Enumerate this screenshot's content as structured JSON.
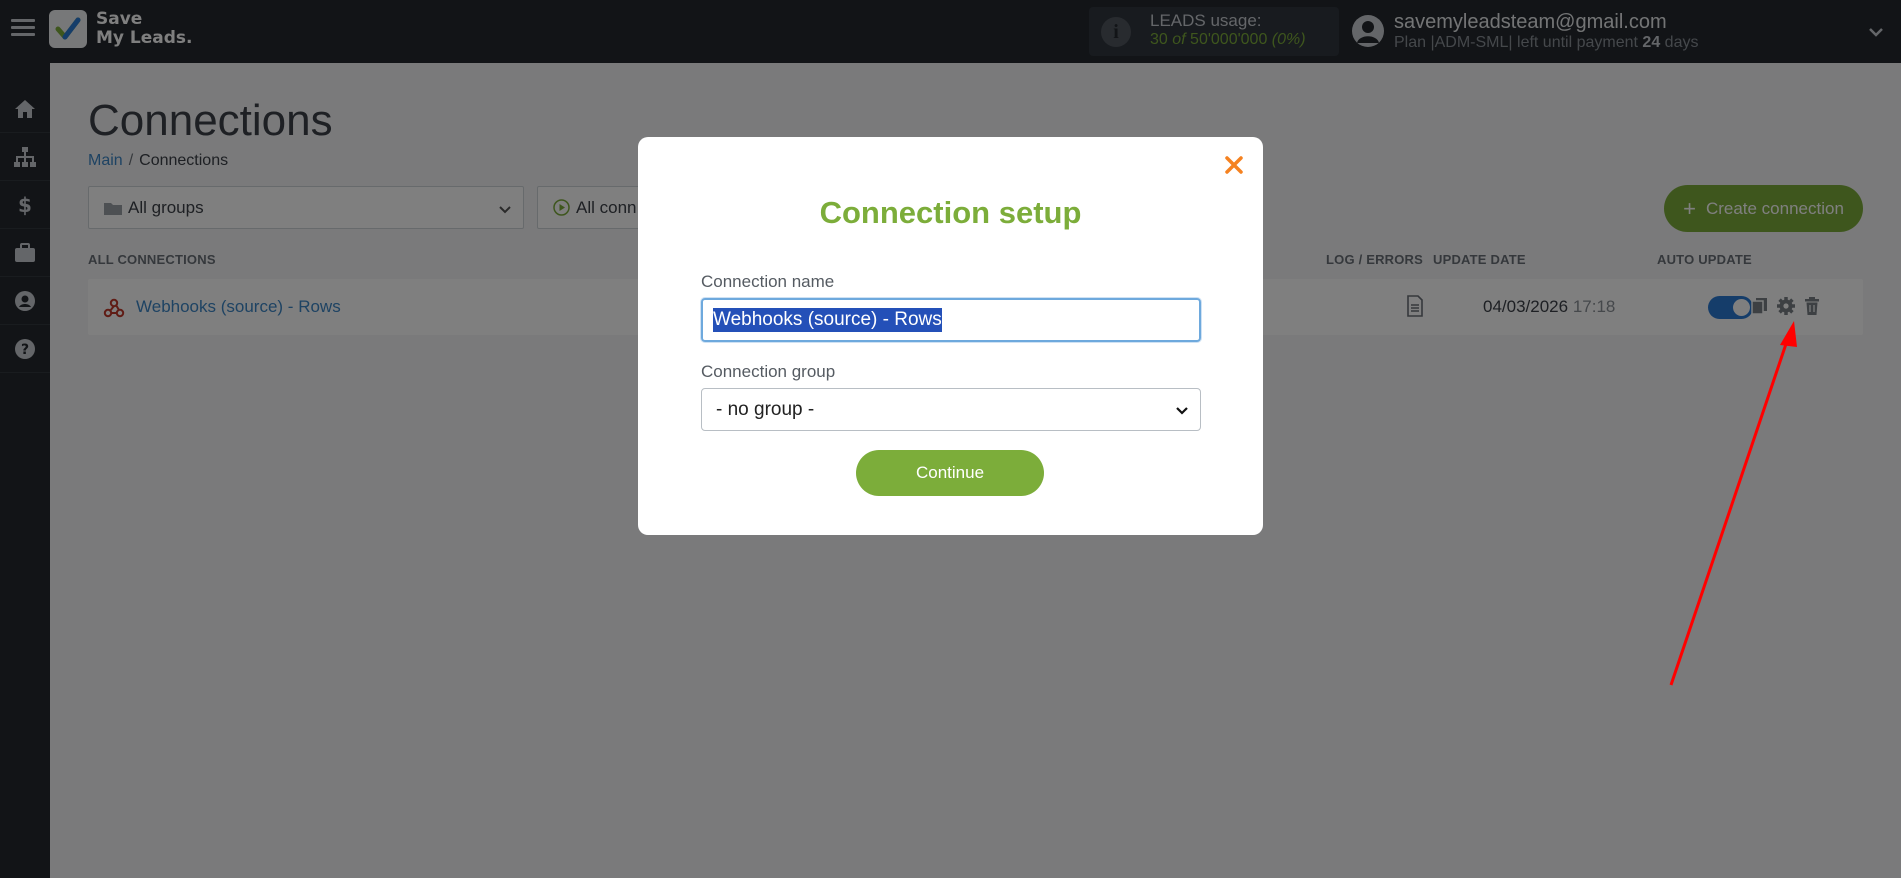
{
  "header": {
    "logo_line1": "Save",
    "logo_line2": "My Leads.",
    "usage_label": "LEADS usage:",
    "usage_used": "30",
    "usage_of": "of",
    "usage_limit": "50'000'000",
    "usage_percent": "(0%)",
    "user_email": "savemyleadsteam@gmail.com",
    "plan_prefix": "Plan |ADM-SML| left until payment",
    "plan_days": "24",
    "plan_suffix": "days"
  },
  "sidebar": {
    "items": [
      "home-icon",
      "sitemap-icon",
      "dollar-icon",
      "briefcase-icon",
      "user-icon",
      "help-icon"
    ]
  },
  "main": {
    "title": "Connections",
    "breadcrumb_main": "Main",
    "breadcrumb_sep": "/",
    "breadcrumb_current": "Connections",
    "groups_filter": "All groups",
    "conn_filter": "All conn",
    "create_button": "Create connection",
    "col_all": "ALL CONNECTIONS",
    "col_log": "LOG / ERRORS",
    "col_date": "UPDATE DATE",
    "col_auto": "AUTO UPDATE",
    "connection": {
      "name": "Webhooks (source) - Rows",
      "date": "04/03/2026",
      "time": "17:18",
      "auto_update": true
    }
  },
  "modal": {
    "title": "Connection setup",
    "name_label": "Connection name",
    "name_value": "Webhooks (source) - Rows",
    "group_label": "Connection group",
    "group_value": "- no group -",
    "continue_button": "Continue"
  },
  "colors": {
    "accent_green": "#7cad3a",
    "link_blue": "#3d86c6",
    "topbar": "#24292f",
    "close_orange": "#f58220",
    "arrow_red": "#ff0000"
  }
}
